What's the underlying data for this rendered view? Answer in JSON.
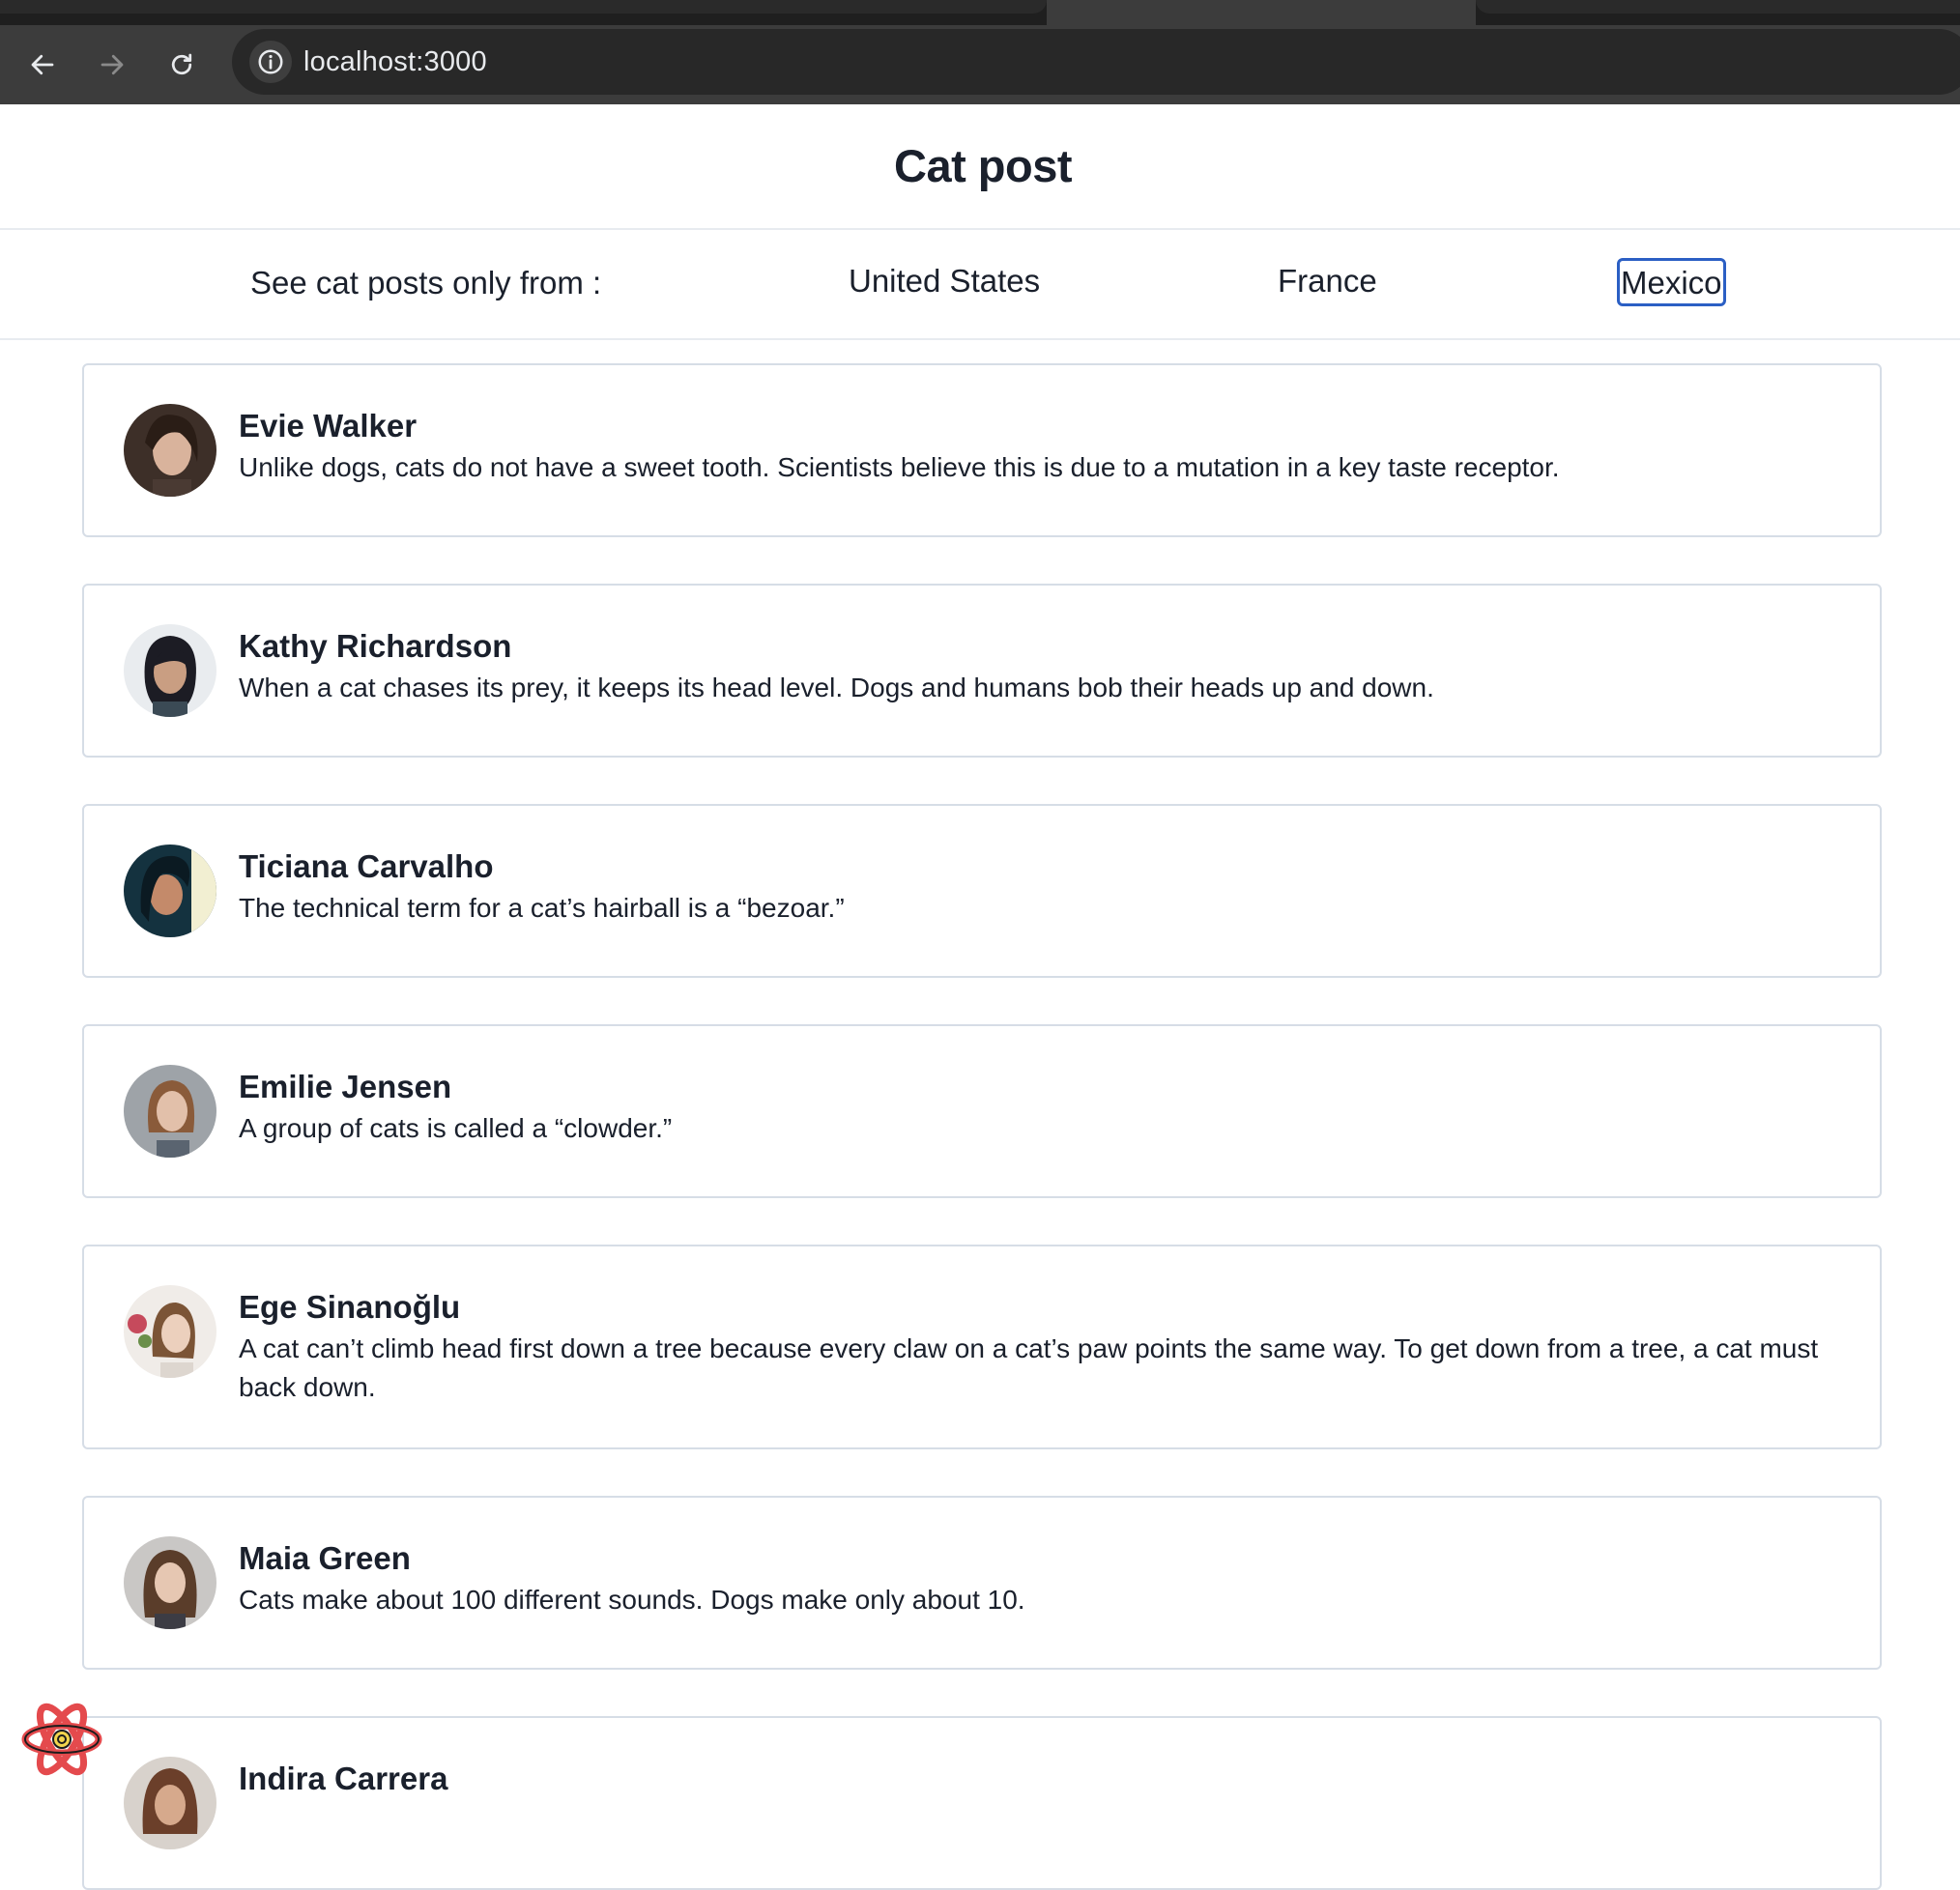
{
  "browser": {
    "url": "localhost:3000",
    "icons": {
      "back": "arrow-left-icon",
      "forward": "arrow-right-icon",
      "reload": "reload-icon",
      "site_info": "info-icon"
    }
  },
  "page": {
    "title": "Cat post",
    "filter": {
      "label": "See cat posts only from :",
      "countries": [
        "United States",
        "France",
        "Mexico"
      ],
      "focused": "Mexico",
      "focus_color": "#2b5fc4"
    },
    "posts": [
      {
        "name": "Evie Walker",
        "text": "Unlike dogs, cats do not have a sweet tooth. Scientists believe this is due to a mutation in a key taste receptor."
      },
      {
        "name": "Kathy Richardson",
        "text": "When a cat chases its prey, it keeps its head level. Dogs and humans bob their heads up and down."
      },
      {
        "name": "Ticiana Carvalho",
        "text": "The technical term for a cat’s hairball is a “bezoar.”"
      },
      {
        "name": "Emilie Jensen",
        "text": "A group of cats is called a “clowder.”"
      },
      {
        "name": "Ege Sinanoğlu",
        "text": "A cat can’t climb head first down a tree because every claw on a cat’s paw points the same way. To get down from a tree, a cat must back down."
      },
      {
        "name": "Maia Green",
        "text": "Cats make about 100 different sounds. Dogs make only about 10."
      },
      {
        "name": "Indira Carrera",
        "text": ""
      }
    ],
    "devtools_icon": "react-devtools-icon"
  }
}
